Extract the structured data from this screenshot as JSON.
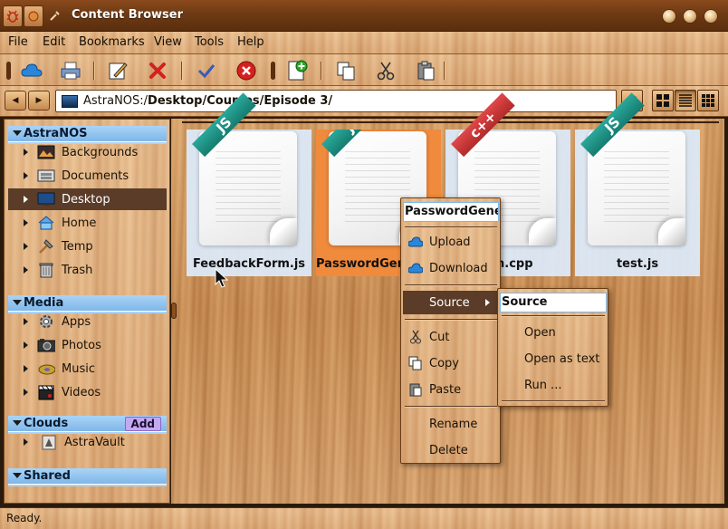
{
  "window": {
    "title": "Content Browser"
  },
  "menu": [
    "File",
    "Edit",
    "Bookmarks",
    "View",
    "Tools",
    "Help"
  ],
  "location": {
    "prefix": "AstraNOS:/",
    "path": "Desktop/Courses/Episode 3/"
  },
  "sidebar": {
    "sections": [
      {
        "title": "AstraNOS",
        "items": [
          "Backgrounds",
          "Documents",
          "Desktop",
          "Home",
          "Temp",
          "Trash"
        ],
        "selected": "Desktop"
      },
      {
        "title": "Media",
        "items": [
          "Apps",
          "Photos",
          "Music",
          "Videos"
        ]
      },
      {
        "title": "Clouds",
        "add_label": "Add",
        "items": [
          "AstraVault"
        ]
      },
      {
        "title": "Shared",
        "items": []
      }
    ]
  },
  "files": [
    {
      "name": "FeedbackForm.js",
      "badge": "JS",
      "selected": false
    },
    {
      "name": "PasswordGene",
      "badge": "JS",
      "selected": true
    },
    {
      "name": "n.cpp",
      "badge": "c++",
      "selected": false
    },
    {
      "name": "test.js",
      "badge": "JS",
      "selected": false
    }
  ],
  "context_menu": {
    "title": "PasswordGenera",
    "items": {
      "upload": "Upload",
      "download": "Download",
      "source": "Source",
      "cut": "Cut",
      "copy": "Copy",
      "paste": "Paste",
      "rename": "Rename",
      "delete": "Delete"
    }
  },
  "submenu": {
    "title": "Source",
    "items": {
      "open": "Open",
      "open_text": "Open as text",
      "run": "Run ..."
    }
  },
  "status": {
    "text": "Ready."
  },
  "colors": {
    "selection": "#f08a3c",
    "header_blue": "#a9d4f7",
    "highlight": "#5a3c28"
  }
}
